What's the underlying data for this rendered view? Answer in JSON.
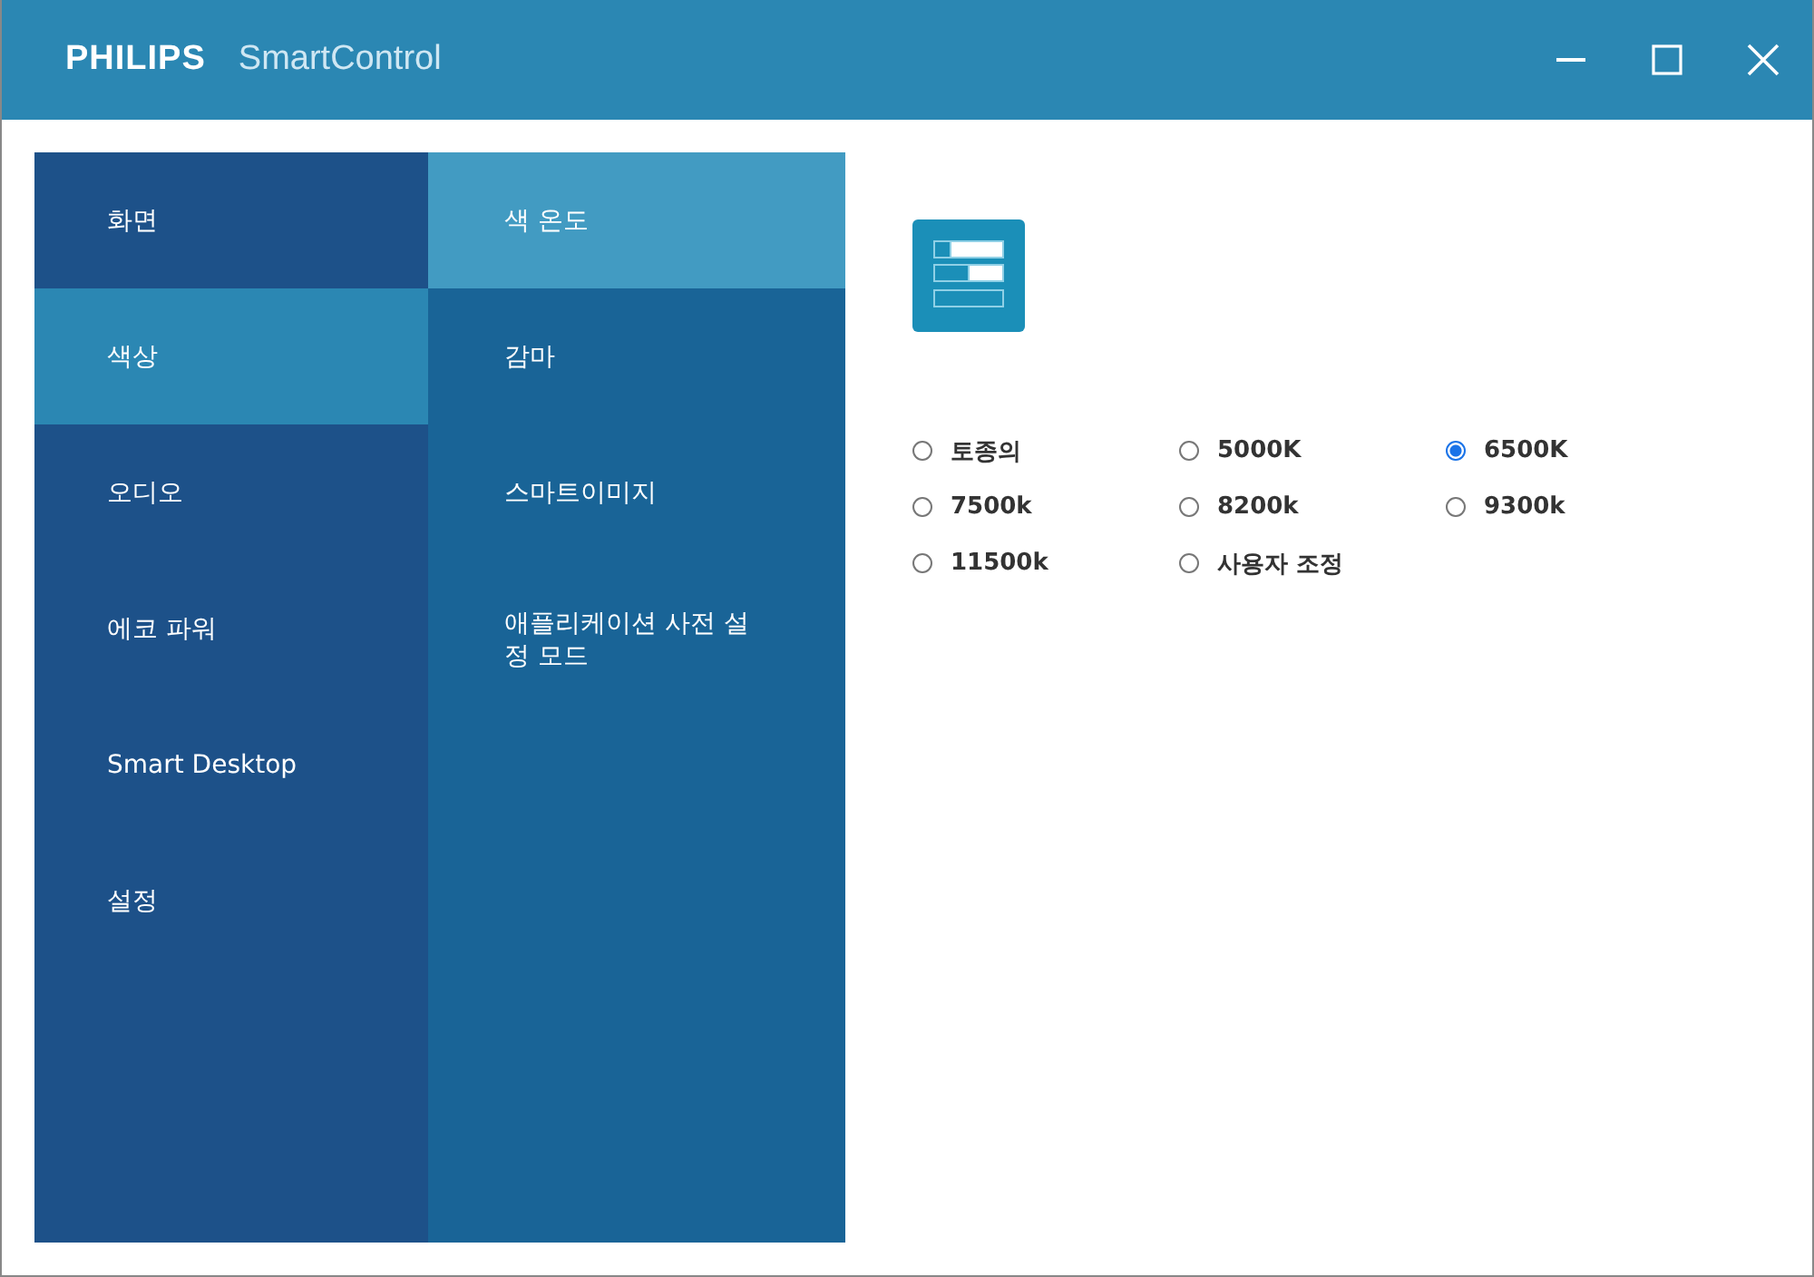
{
  "window": {
    "brand": "PHILIPS",
    "title": "SmartControl"
  },
  "menu": [
    {
      "label": "화면",
      "selected": false
    },
    {
      "label": "색상",
      "selected": true
    },
    {
      "label": "오디오",
      "selected": false
    },
    {
      "label": "에코 파워",
      "selected": false
    },
    {
      "label": "Smart Desktop",
      "selected": false
    },
    {
      "label": "설정",
      "selected": false
    }
  ],
  "submenu": [
    {
      "label": "색 온도",
      "selected": true
    },
    {
      "label": "감마",
      "selected": false
    },
    {
      "label": "스마트이미지",
      "selected": false
    },
    {
      "label": "애플리케이션 사전 설정 모드",
      "selected": false
    }
  ],
  "color_temperature": [
    {
      "label": "토종의",
      "selected": false
    },
    {
      "label": "5000K",
      "selected": false
    },
    {
      "label": "6500K",
      "selected": true
    },
    {
      "label": "7500k",
      "selected": false
    },
    {
      "label": "8200k",
      "selected": false
    },
    {
      "label": "9300k",
      "selected": false
    },
    {
      "label": "11500k",
      "selected": false
    },
    {
      "label": "사용자 조정",
      "selected": false
    }
  ]
}
